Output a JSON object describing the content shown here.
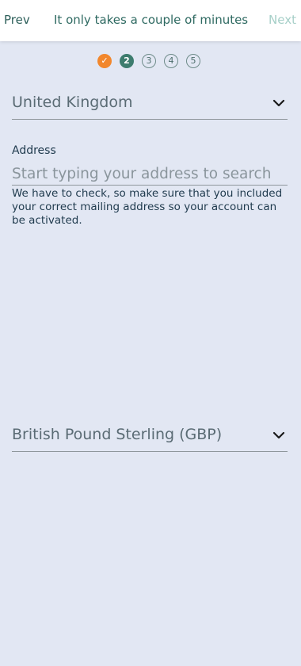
{
  "header": {
    "prev_label": "Prev",
    "title": "It only takes a couple of minutes",
    "next_label": "Next"
  },
  "stepper": {
    "completed_icon": "check-icon",
    "steps": [
      "✓",
      "2",
      "3",
      "4",
      "5"
    ],
    "current_step": 2,
    "colors": {
      "completed": "#f2872c",
      "current": "#3d7c6e"
    }
  },
  "country_select": {
    "value": "United Kingdom",
    "icon": "chevron-down-icon"
  },
  "address": {
    "label": "Address",
    "placeholder": "Start typing your address to search",
    "value": "",
    "help_text": "We have to check, so make sure that you included your correct mailing address so your account can be activated."
  },
  "currency_select": {
    "value": "British Pound Sterling (GBP)",
    "icon": "chevron-down-icon"
  }
}
